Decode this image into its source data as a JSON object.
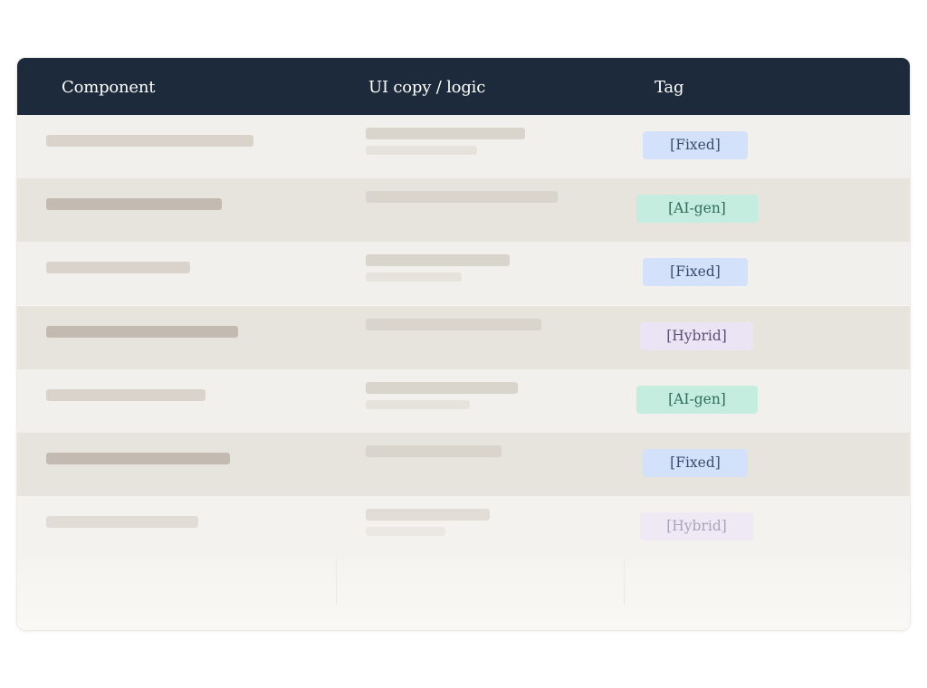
{
  "table": {
    "columns": {
      "component": "Component",
      "copy": "UI copy / logic",
      "tag": "Tag"
    },
    "rows": [
      {
        "tag": "[Fixed]"
      },
      {
        "tag": "[AI-gen]"
      },
      {
        "tag": "[Fixed]"
      },
      {
        "tag": "[Hybrid]"
      },
      {
        "tag": "[AI-gen]"
      },
      {
        "tag": "[Fixed]"
      },
      {
        "tag": "[Hybrid]"
      }
    ]
  },
  "colors": {
    "header_bg": "#1c2a3b",
    "fixed_tag_bg": "#d3e2fa",
    "aigen_tag_bg": "#c4ede0",
    "hybrid_tag_bg": "#ebe4f5"
  }
}
